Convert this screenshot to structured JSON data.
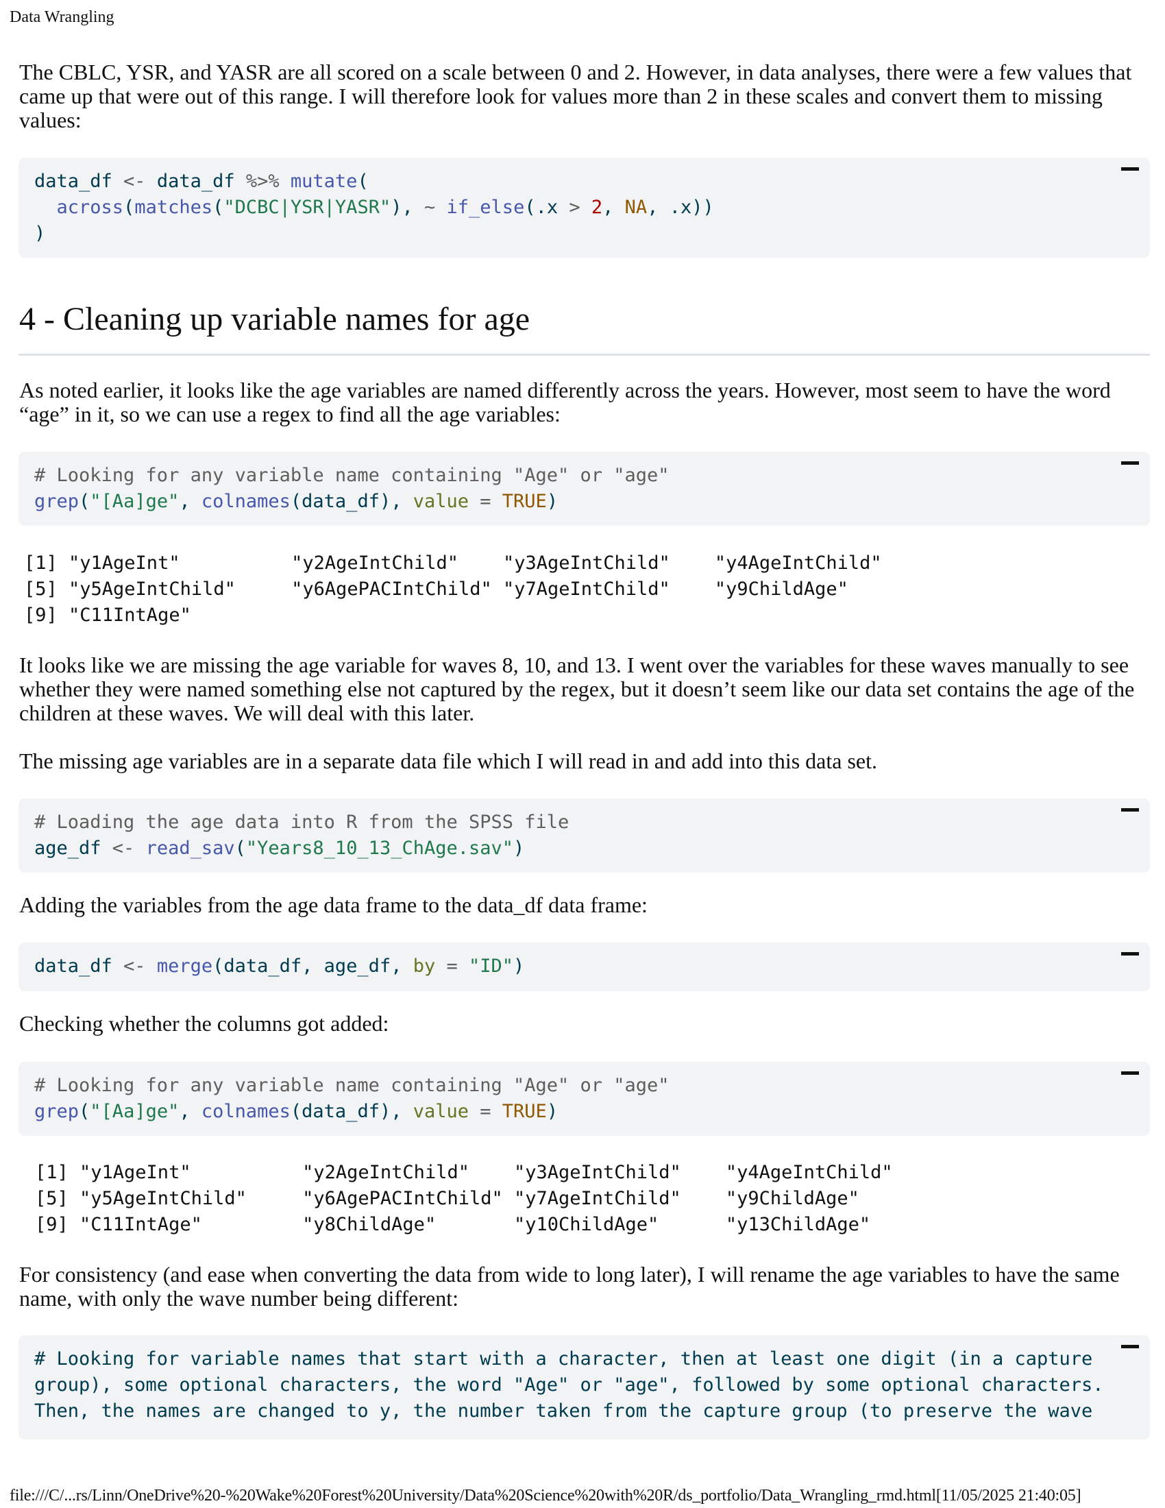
{
  "print_header": "Data Wrangling",
  "print_footer": "file:///C/...rs/Linn/OneDrive%20-%20Wake%20Forest%20University/Data%20Science%20with%20R/ds_portfolio/Data_Wrangling_rmd.html[11/05/2025 21:40:05]",
  "para_scale": "The CBLC, YSR, and YASR are all scored on a scale between 0 and 2. However, in data analyses, there were a few values that came up that were out of this range. I will therefore look for values more than 2 in these scales and convert them to missing values:",
  "code1": {
    "l1a": "data_df",
    "l1b": " <- ",
    "l1c": "data_df",
    "l1d": " %>% ",
    "l1e": "mutate",
    "l1f": "(",
    "l2a": "  across",
    "l2b": "(",
    "l2c": "matches",
    "l2d": "(",
    "l2e": "\"DCBC|YSR|YASR\"",
    "l2f": "), ",
    "l2g": "~",
    "l2h": " ",
    "l2i": "if_else",
    "l2j": "(.x ",
    "l2k": ">",
    "l2l": " ",
    "l2m": "2",
    "l2n": ", ",
    "l2o": "NA",
    "l2p": ", .x))",
    "l3": ")"
  },
  "section_heading": "4 - Cleaning up variable names for age",
  "para_age_intro": "As noted earlier, it looks like the age variables are named differently across the years. However, most seem to have the word “age” in it, so we can use a regex to find all the age variables:",
  "code2": {
    "comment": "# Looking for any variable name containing \"Age\" or \"age\"",
    "l2a": "grep",
    "l2b": "(",
    "l2c": "\"[Aa]ge\"",
    "l2d": ", ",
    "l2e": "colnames",
    "l2f": "(data_df), ",
    "l2g": "value",
    "l2h": " = ",
    "l2i": "TRUE",
    "l2j": ")"
  },
  "output1": [
    "[1] \"y1AgeInt\"          \"y2AgeIntChild\"    \"y3AgeIntChild\"    \"y4AgeIntChild\"",
    "[5] \"y5AgeIntChild\"     \"y6AgePACIntChild\" \"y7AgeIntChild\"    \"y9ChildAge\"",
    "[9] \"C11IntAge\""
  ],
  "para_missing": "It looks like we are missing the age variable for waves 8, 10, and 13. I went over the variables for these waves manually to see whether they were named something else not captured by the regex, but it doesn’t seem like our data set contains the age of the children at these waves. We will deal with this later.",
  "para_separate": "The missing age variables are in a separate data file which I will read in and add into this data set.",
  "code3": {
    "comment": "# Loading the age data into R from the SPSS file",
    "l2a": "age_df",
    "l2b": " <- ",
    "l2c": "read_sav",
    "l2d": "(",
    "l2e": "\"Years8_10_13_ChAge.sav\"",
    "l2f": ")"
  },
  "para_adding": "Adding the variables from the age data frame to the data_df data frame:",
  "code4": {
    "a": "data_df",
    "b": " <- ",
    "c": "merge",
    "d": "(data_df, age_df, ",
    "e": "by",
    "f": " = ",
    "g": "\"ID\"",
    "h": ")"
  },
  "para_checking": "Checking whether the columns got added:",
  "code5": {
    "comment": "# Looking for any variable name containing \"Age\" or \"age\"",
    "l2a": "grep",
    "l2b": "(",
    "l2c": "\"[Aa]ge\"",
    "l2d": ", ",
    "l2e": "colnames",
    "l2f": "(data_df), ",
    "l2g": "value",
    "l2h": " = ",
    "l2i": "TRUE",
    "l2j": ")"
  },
  "output2": [
    "[1] \"y1AgeInt\"          \"y2AgeIntChild\"    \"y3AgeIntChild\"    \"y4AgeIntChild\"",
    "[5] \"y5AgeIntChild\"     \"y6AgePACIntChild\" \"y7AgeIntChild\"    \"y9ChildAge\"",
    "[9] \"C11IntAge\"         \"y8ChildAge\"       \"y10ChildAge\"      \"y13ChildAge\""
  ],
  "para_consistency": "For consistency (and ease when converting the data from wide to long later), I will rename the age variables to have the same name, with only the wave number being different:",
  "code6": {
    "c1": "# Looking for variable names that start with a character, then at least one digit (in a capture",
    "c2": "group), some optional characters, the word \"Age\" or \"age\", followed by some optional characters.",
    "c3": "Then, the names are changed to y, the number taken from the capture group (to preserve the wave"
  }
}
